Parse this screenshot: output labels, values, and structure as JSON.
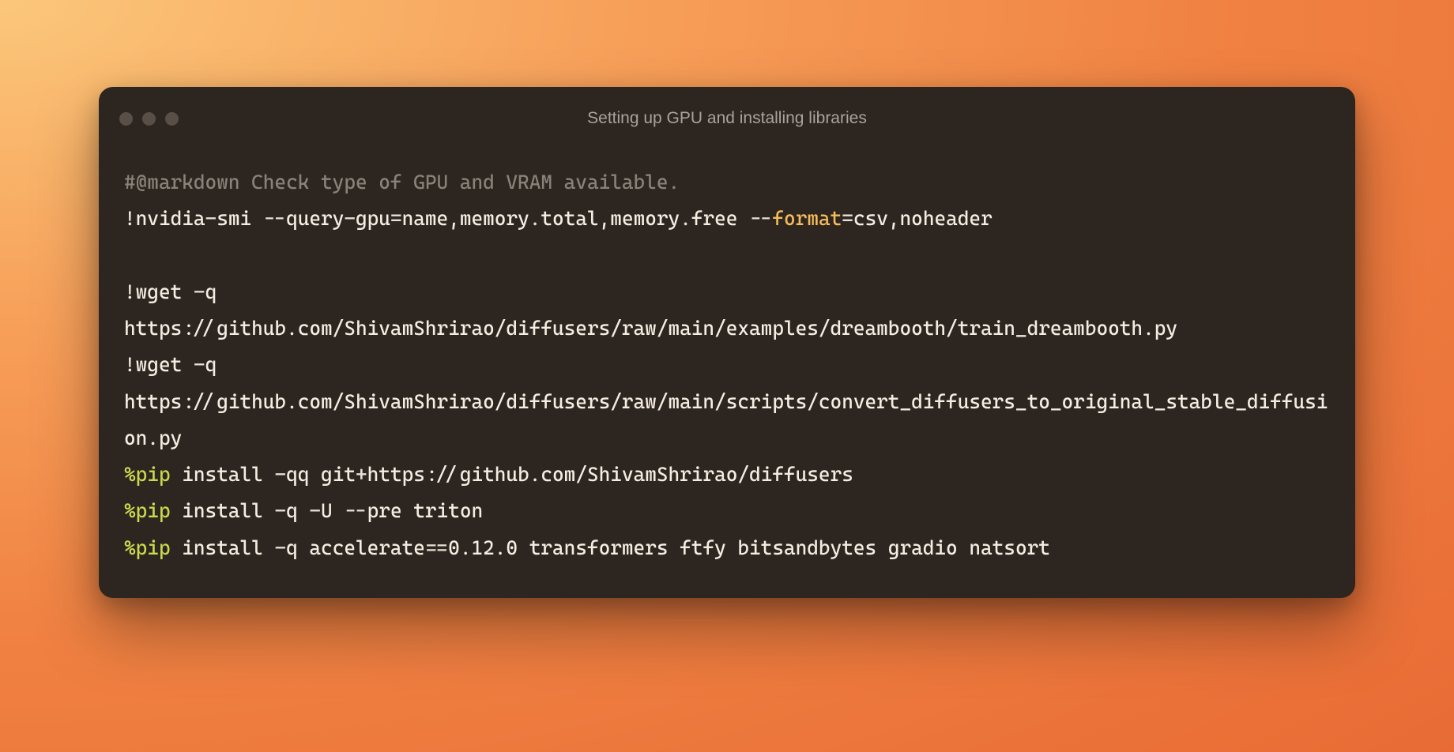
{
  "window": {
    "title": "Setting up GPU and installing libraries"
  },
  "code": {
    "comment": "#@markdown Check type of GPU and VRAM available.",
    "line1": {
      "bang": "!",
      "cmd1": "nvidia",
      "dash1": "-",
      "cmd2": "smi ",
      "dash2": "--",
      "cmd3": "query",
      "dash3": "-",
      "cmd4": "gpu",
      "eq1": "=",
      "arg1": "name,memory",
      "dot1": ".",
      "arg2": "total,memory",
      "dot2": ".",
      "arg3": "free ",
      "dash4": "--",
      "flag": "format",
      "eq2": "=",
      "arg4": "csv,noheader"
    },
    "line2": {
      "bang": "!",
      "cmd": "wget ",
      "dash": "-",
      "flag": "q "
    },
    "url1": "https://github.com/ShivamShrirao/diffusers/raw/main/examples/dreambooth/train_dreambooth.py",
    "line3": {
      "bang": "!",
      "cmd": "wget ",
      "dash": "-",
      "flag": "q "
    },
    "url2": "https://github.com/ShivamShrirao/diffusers/raw/main/scripts/convert_diffusers_to_original_stable_diffusion.py",
    "pip1": {
      "magic": "%pip",
      "rest": " install ",
      "dash1": "-",
      "flag1": "qq git",
      "plus": "+",
      "url": "https://github.com/ShivamShrirao/diffusers"
    },
    "pip2": {
      "magic": "%pip",
      "rest": " install ",
      "dash1": "-",
      "flag1": "q ",
      "dash2": "-",
      "flag2": "U ",
      "dash3": "--",
      "flag3": "pre triton"
    },
    "pip3": {
      "magic": "%pip",
      "rest": " install ",
      "dash1": "-",
      "flag1": "q accelerate",
      "eq": "==",
      "ver": "0.12.0",
      "rest2": " transformers ftfy bitsandbytes gradio natsort"
    }
  }
}
